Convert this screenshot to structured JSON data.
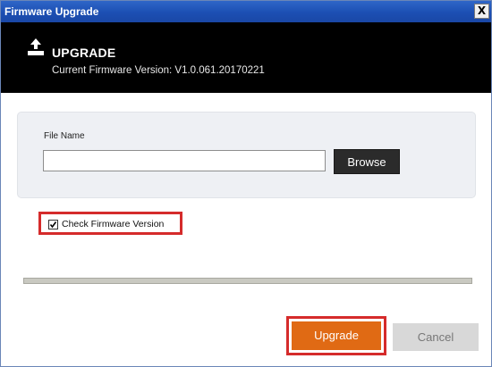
{
  "window": {
    "title": "Firmware Upgrade",
    "close_label": "X"
  },
  "header": {
    "icon": "upload-icon",
    "title": "UPGRADE",
    "firmware_version": "Current Firmware Version: V1.0.061.20170221"
  },
  "file": {
    "label": "File Name",
    "value": "",
    "placeholder": "",
    "browse_label": "Browse"
  },
  "check_firmware": {
    "label": "Check Firmware Version",
    "checked": true
  },
  "progress": {
    "fraction": 0
  },
  "buttons": {
    "upgrade_label": "Upgrade",
    "cancel_label": "Cancel"
  },
  "colors": {
    "titlebar": "#1c4fb3",
    "header_bg": "#000000",
    "upgrade_button": "#e06a14",
    "highlight_outline": "#d52b2b"
  }
}
